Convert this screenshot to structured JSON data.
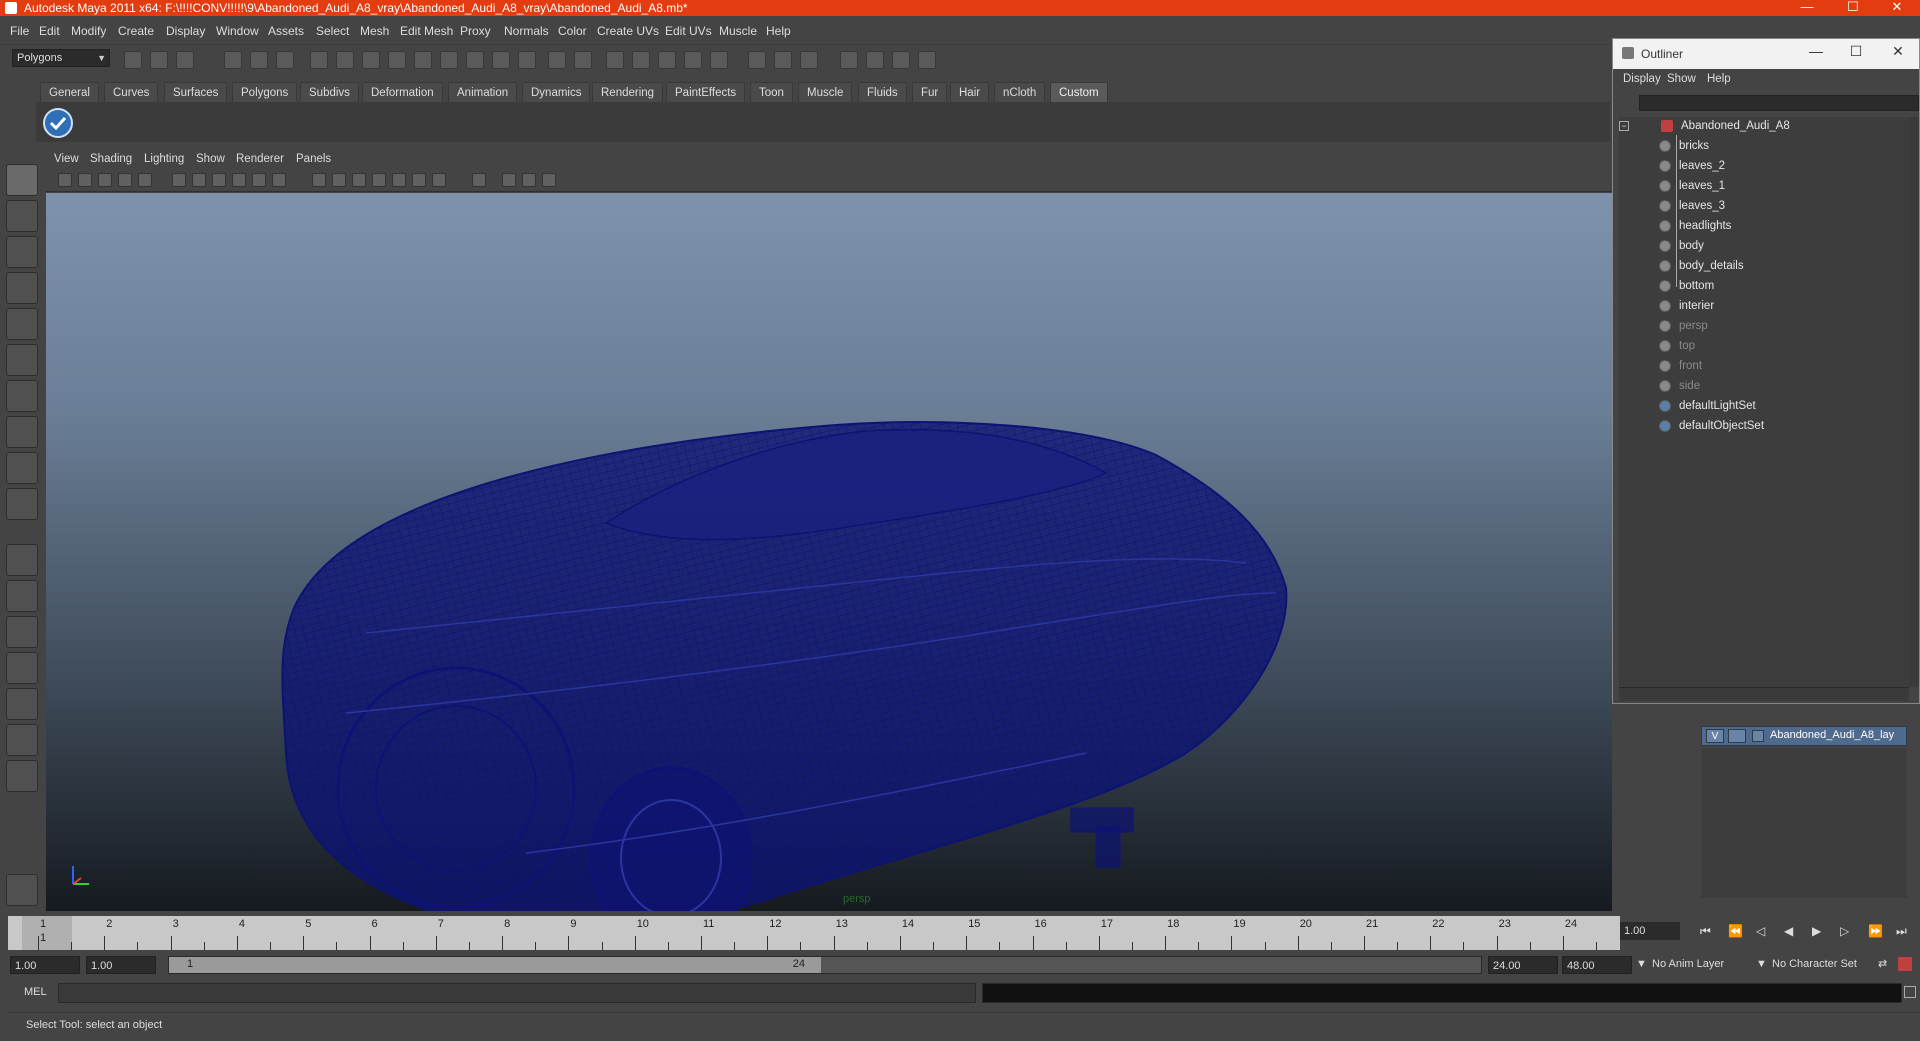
{
  "window": {
    "title": "Autodesk Maya 2011 x64: F:\\!!!!CONV!!!!!\\9\\Abandoned_Audi_A8_vray\\Abandoned_Audi_A8_vray\\Abandoned_Audi_A8.mb*",
    "minimize": "—",
    "maximize": "☐",
    "close": "✕"
  },
  "menubar": [
    "File",
    "Edit",
    "Modify",
    "Create",
    "Display",
    "Window",
    "Assets",
    "Select",
    "Mesh",
    "Edit Mesh",
    "Proxy",
    "Normals",
    "Color",
    "Create UVs",
    "Edit UVs",
    "Muscle",
    "Help"
  ],
  "statusline": {
    "mode": "Polygons"
  },
  "shelf": {
    "tabs": [
      "General",
      "Curves",
      "Surfaces",
      "Polygons",
      "Subdivs",
      "Deformation",
      "Animation",
      "Dynamics",
      "Rendering",
      "PaintEffects",
      "Toon",
      "Muscle",
      "Fluids",
      "Fur",
      "Hair",
      "nCloth",
      "Custom"
    ],
    "active_tab": "Custom"
  },
  "viewport": {
    "menu": [
      "View",
      "Shading",
      "Lighting",
      "Show",
      "Renderer",
      "Panels"
    ],
    "camera_label": "persp",
    "wire_color": "#0d1373"
  },
  "outliner": {
    "title": "Outliner",
    "menu": [
      "Display",
      "Show",
      "Help"
    ],
    "root": "Abandoned_Audi_A8",
    "children": [
      "bricks",
      "leaves_2",
      "leaves_1",
      "leaves_3",
      "headlights",
      "body",
      "body_details",
      "bottom",
      "interier"
    ],
    "cameras": [
      "persp",
      "top",
      "front",
      "side"
    ],
    "sets": [
      "defaultLightSet",
      "defaultObjectSet"
    ]
  },
  "layers": {
    "visible_flag": "V",
    "name": "Abandoned_Audi_A8_lay"
  },
  "timeline": {
    "ticks": [
      "1",
      "2",
      "3",
      "4",
      "5",
      "6",
      "7",
      "8",
      "9",
      "10",
      "11",
      "12",
      "13",
      "14",
      "15",
      "16",
      "17",
      "18",
      "19",
      "20",
      "21",
      "22",
      "23",
      "24"
    ],
    "current_marker": "1",
    "current_frame": "1.00"
  },
  "range": {
    "start": "1.00",
    "playback_start": "1.00",
    "handle_start": "1",
    "handle_end": "24",
    "playback_end": "24.00",
    "end": "48.00",
    "anim_layer": "No Anim Layer",
    "char_set": "No Character Set"
  },
  "command": {
    "label": "MEL"
  },
  "help": {
    "text": "Select Tool: select an object"
  }
}
